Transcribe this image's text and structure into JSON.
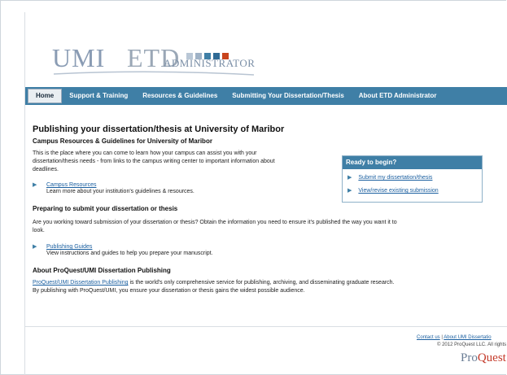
{
  "logo": {
    "umi": "UMI",
    "etd": "ETD",
    "admin": "ADMINISTRATOR",
    "squares_colors": [
      "#b9c7d6",
      "#9fb2c6",
      "#3f7fa6",
      "#2f6a95",
      "#c8441d"
    ]
  },
  "nav": {
    "tabs": [
      {
        "label": "Home",
        "active": true
      },
      {
        "label": "Support & Training"
      },
      {
        "label": "Resources & Guidelines"
      },
      {
        "label": "Submitting Your Dissertation/Thesis"
      },
      {
        "label": "About ETD Administrator"
      }
    ]
  },
  "main": {
    "title": "Publishing your dissertation/thesis at University of Maribor",
    "section1": {
      "heading": "Campus Resources & Guidelines for University of Maribor",
      "text_line1": "This is the place where you can come to learn how your campus can assist you with your",
      "text_line2": "dissertation/thesis needs - from links to the campus writing center to important information about",
      "text_line3": "deadlines.",
      "link": "Campus Resources",
      "link_desc": "Learn more about your institution's guidelines & resources."
    },
    "section2": {
      "heading": "Preparing to submit your dissertation or thesis",
      "text_line1": "Are you working toward submission of your dissertation or thesis? Obtain the information you need to ensure it's published the way you want it to",
      "text_line2": "look.",
      "link": "Publishing Guides",
      "link_desc": "View instructions and guides to help you prepare your manuscript."
    },
    "section3": {
      "heading": "About ProQuest/UMI Dissertation Publishing",
      "link": "ProQuest/UMI Dissertation Publishing",
      "text_line1_rest": " is the world's only comprehensive service for publishing, archiving, and disseminating graduate research.",
      "text_line2": "By publishing with ProQuest/UMI, you ensure your dissertation or thesis gains the widest possible audience."
    }
  },
  "ready": {
    "heading": "Ready to begin?",
    "items": [
      "Submit my dissertation/thesis",
      "View/revise existing submission"
    ]
  },
  "footer": {
    "contact": "Contact us",
    "separator": " | ",
    "about": "About UMI Dissertatio",
    "copyright": "© 2012 ProQuest LLC. All rights",
    "brand_pro": "Pro",
    "brand_quest": "Quest"
  }
}
